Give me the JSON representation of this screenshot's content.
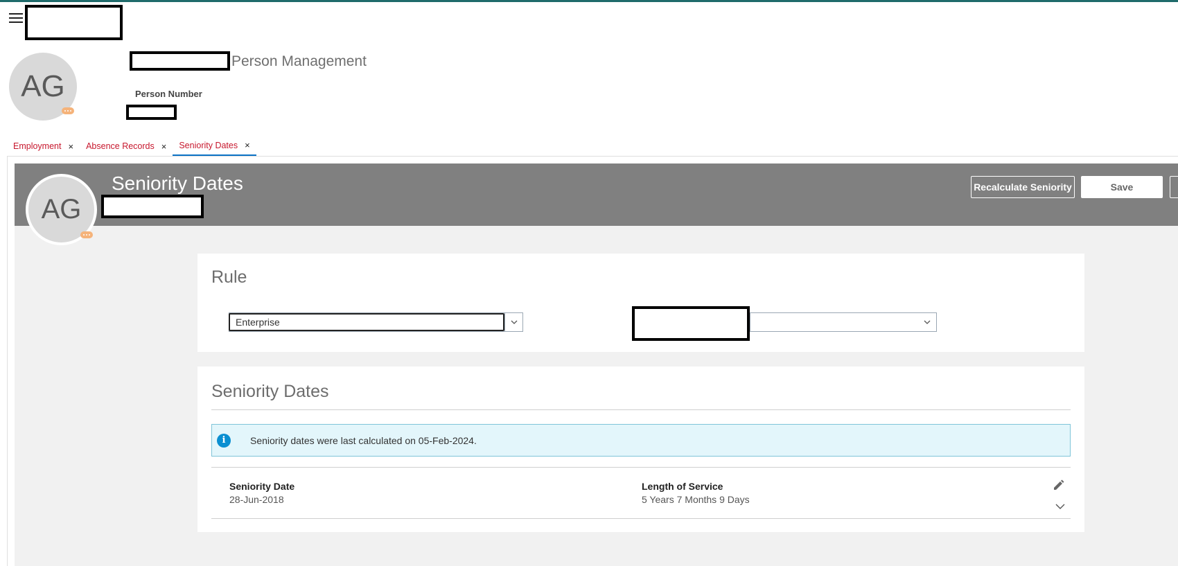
{
  "header": {
    "app_title": "Person Management",
    "person_number_label": "Person Number",
    "initials": "AG",
    "menu_icon": "hamburger-menu-icon"
  },
  "tabs": [
    {
      "label": "Employment",
      "close": "×"
    },
    {
      "label": "Absence Records",
      "close": "×"
    },
    {
      "label": "Seniority Dates",
      "close": "×",
      "active": true
    }
  ],
  "banner": {
    "title": "Seniority Dates",
    "initials": "AG",
    "recalculate_label": "Recalculate Seniority",
    "save_label": "Save"
  },
  "rule_card": {
    "title": "Rule",
    "primary_select_value": "Enterprise",
    "secondary_select_value": ""
  },
  "seniority_card": {
    "title": "Seniority Dates",
    "info_message": "Seniority dates were last calculated on 05-Feb-2024.",
    "seniority_date_label": "Seniority Date",
    "seniority_date_value": "28-Jun-2018",
    "length_of_service_label": "Length of Service",
    "length_of_service_value": "5 Years 7 Months 9 Days"
  },
  "colors": {
    "accent_tab": "#c7172d",
    "tab_underline": "#0a72c5",
    "banner": "#808080",
    "info_bg": "#e3f6fb",
    "info_icon": "#0a8fd1",
    "top_border": "#1f6b6b"
  }
}
